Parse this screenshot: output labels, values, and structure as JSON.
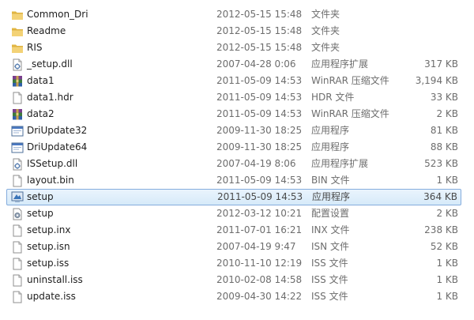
{
  "files": [
    {
      "name": "Common_Dri",
      "date": "2012-05-15 15:48",
      "type": "文件夹",
      "size": "",
      "icon": "folder-icon"
    },
    {
      "name": "Readme",
      "date": "2012-05-15 15:48",
      "type": "文件夹",
      "size": "",
      "icon": "folder-icon"
    },
    {
      "name": "RIS",
      "date": "2012-05-15 15:48",
      "type": "文件夹",
      "size": "",
      "icon": "folder-icon"
    },
    {
      "name": "_setup.dll",
      "date": "2007-04-28 0:06",
      "type": "应用程序扩展",
      "size": "317 KB",
      "icon": "dll-icon"
    },
    {
      "name": "data1",
      "date": "2011-05-09 14:53",
      "type": "WinRAR 压缩文件",
      "size": "3,194 KB",
      "icon": "winrar-icon"
    },
    {
      "name": "data1.hdr",
      "date": "2011-05-09 14:53",
      "type": "HDR 文件",
      "size": "33 KB",
      "icon": "file-icon"
    },
    {
      "name": "data2",
      "date": "2011-05-09 14:53",
      "type": "WinRAR 压缩文件",
      "size": "2 KB",
      "icon": "winrar-icon"
    },
    {
      "name": "DriUpdate32",
      "date": "2009-11-30 18:25",
      "type": "应用程序",
      "size": "81 KB",
      "icon": "app-icon"
    },
    {
      "name": "DriUpdate64",
      "date": "2009-11-30 18:25",
      "type": "应用程序",
      "size": "88 KB",
      "icon": "app-icon"
    },
    {
      "name": "ISSetup.dll",
      "date": "2007-04-19 8:06",
      "type": "应用程序扩展",
      "size": "523 KB",
      "icon": "dll-icon"
    },
    {
      "name": "layout.bin",
      "date": "2011-05-09 14:53",
      "type": "BIN 文件",
      "size": "1 KB",
      "icon": "file-icon"
    },
    {
      "name": "setup",
      "date": "2011-05-09 14:53",
      "type": "应用程序",
      "size": "364 KB",
      "icon": "setup-icon",
      "selected": true
    },
    {
      "name": "setup",
      "date": "2012-03-12 10:21",
      "type": "配置设置",
      "size": "2 KB",
      "icon": "config-icon"
    },
    {
      "name": "setup.inx",
      "date": "2011-07-01 16:21",
      "type": "INX 文件",
      "size": "238 KB",
      "icon": "file-icon"
    },
    {
      "name": "setup.isn",
      "date": "2007-04-19 9:47",
      "type": "ISN 文件",
      "size": "52 KB",
      "icon": "file-icon"
    },
    {
      "name": "setup.iss",
      "date": "2010-11-10 12:19",
      "type": "ISS 文件",
      "size": "1 KB",
      "icon": "file-icon"
    },
    {
      "name": "uninstall.iss",
      "date": "2010-02-08 14:58",
      "type": "ISS 文件",
      "size": "1 KB",
      "icon": "file-icon"
    },
    {
      "name": "update.iss",
      "date": "2009-04-30 14:22",
      "type": "ISS 文件",
      "size": "1 KB",
      "icon": "file-icon"
    }
  ],
  "colors": {
    "folder": "#e8c25a",
    "selection_border": "#84acdd",
    "selection_fill": "#d6eaf9",
    "meta_text": "#6d6d6d"
  }
}
